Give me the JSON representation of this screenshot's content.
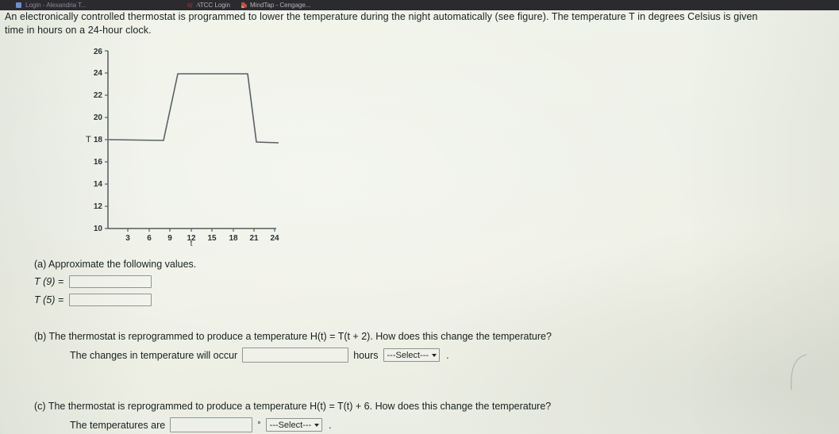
{
  "browser": {
    "bookmarks": [
      {
        "label": "Login - Alexandria T...",
        "icon": "blue-square-icon"
      },
      {
        "label": "ATCC Login",
        "icon": "red-flag-icon"
      },
      {
        "label": "MindTap - Cengage...",
        "icon": "multicolor-dots-icon"
      }
    ]
  },
  "problem": {
    "intro_line1": "An electronically controlled thermostat is programmed to lower the temperature during the night automatically (see figure). The temperature T in degrees Celsius is given",
    "intro_line2": "time in hours on a 24-hour clock."
  },
  "chart_data": {
    "type": "line",
    "title": "",
    "xlabel": "t",
    "ylabel": "T",
    "xlim": [
      0,
      25
    ],
    "ylim": [
      10,
      26
    ],
    "xticks": [
      3,
      6,
      9,
      12,
      15,
      18,
      21,
      24
    ],
    "yticks": [
      10,
      12,
      14,
      16,
      18,
      20,
      22,
      24,
      26
    ],
    "grid": false,
    "legend": "none",
    "series": [
      {
        "name": "T(t)",
        "x": [
          0,
          8,
          10,
          20,
          21,
          24
        ],
        "y": [
          18,
          18,
          24,
          24,
          18,
          18
        ]
      }
    ]
  },
  "parts": {
    "a": {
      "label": "(a) Approximate the following values.",
      "fields": [
        {
          "label": "T (9) =",
          "value": "",
          "placeholder": ""
        },
        {
          "label": "T (5) =",
          "value": "",
          "placeholder": ""
        }
      ]
    },
    "b": {
      "label": "(b) The thermostat is reprogrammed to produce a temperature H(t) = T(t + 2). How does this change the temperature?",
      "answer_prefix": "The changes in temperature will occur",
      "input_value": "",
      "unit": "hours",
      "select_value": "---Select---",
      "trailing": "."
    },
    "c": {
      "label": "(c) The thermostat is reprogrammed to produce a temperature H(t) = T(t) + 6. How does this change the temperature?",
      "answer_prefix": "The temperatures are",
      "input_value": "",
      "unit": "°",
      "select_value": "---Select---",
      "trailing": "."
    }
  },
  "colors": {
    "paper": "#eef1e8",
    "ink": "#17201e",
    "curve": "#4c5258",
    "axis": "#555b61",
    "chrome": "#2b2a2f"
  }
}
